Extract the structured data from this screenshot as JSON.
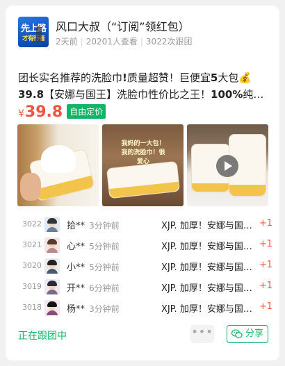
{
  "header": {
    "logo_text_1": "先上路",
    "logo_text_2": "才有行者",
    "title": "风口大叔（“订阅”领红包）",
    "time_ago": "2天前",
    "views": "20201人查看",
    "follows": "3022次跟团"
  },
  "product": {
    "desc_1": "团长实名推荐的洗脸巾",
    "desc_2": "!",
    "desc_3": "质量超赞！巨便宜",
    "desc_4": "5",
    "desc_5": "大包",
    "desc_6": "💰39.8",
    "desc_7": "【安娜与国王】洗脸巾性价比之王！",
    "desc_8": "100%",
    "desc_9": "纯…",
    "price_symbol": "¥",
    "price": "39.8",
    "price_tag": "自由定价",
    "image2_caption": "我妈的一大包！我的洗脸巾！很爱心"
  },
  "orders": [
    {
      "no": "3022",
      "name": "拾**",
      "time": "3分钟前",
      "product": "XJP. 加厚！安娜与国王 洗脸巾",
      "count": "+1"
    },
    {
      "no": "3021",
      "name": "心**",
      "time": "5分钟前",
      "product": "XJP. 加厚！安娜与国王 洗脸巾",
      "count": "+1"
    },
    {
      "no": "3020",
      "name": "小**",
      "time": "5分钟前",
      "product": "XJP. 加厚！安娜与国王 洗脸巾",
      "count": "+1"
    },
    {
      "no": "3019",
      "name": "开**",
      "time": "6分钟前",
      "product": "XJP. 加厚！安娜与国王 洗脸巾",
      "count": "+1"
    },
    {
      "no": "3018",
      "name": "杨**",
      "time": "3分钟前",
      "product": "XJP. 加厚！安娜与国王 洗脸巾",
      "count": "+1"
    }
  ],
  "footer": {
    "status": "正在跟团中",
    "more_label": "•••",
    "share_label": "分享"
  },
  "colors": {
    "accent": "#12b565",
    "price": "#f2553d"
  }
}
